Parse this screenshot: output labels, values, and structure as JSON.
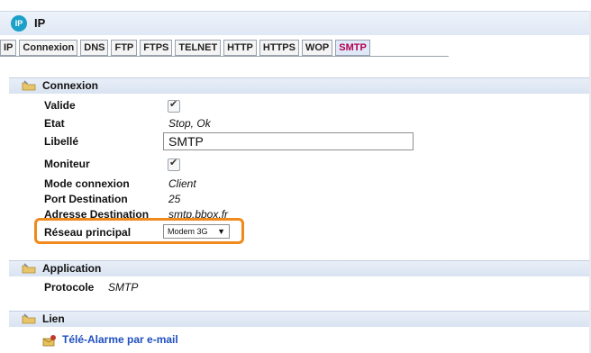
{
  "window": {
    "title": "IP",
    "logo_text": "IP"
  },
  "tabs": [
    {
      "label": "IP",
      "active": false
    },
    {
      "label": "Connexion",
      "active": false
    },
    {
      "label": "DNS",
      "active": false
    },
    {
      "label": "FTP",
      "active": false
    },
    {
      "label": "FTPS",
      "active": false
    },
    {
      "label": "TELNET",
      "active": false
    },
    {
      "label": "HTTP",
      "active": false
    },
    {
      "label": "HTTPS",
      "active": false
    },
    {
      "label": "WOP",
      "active": false
    },
    {
      "label": "SMTP",
      "active": true
    }
  ],
  "connexion": {
    "title": "Connexion",
    "valide_label": "Valide",
    "valide_checked": true,
    "etat_label": "Etat",
    "etat_value": "Stop, Ok",
    "libelle_label": "Libellé",
    "libelle_value": "SMTP",
    "moniteur_label": "Moniteur",
    "moniteur_checked": true,
    "mode_label": "Mode connexion",
    "mode_value": "Client",
    "port_label": "Port Destination",
    "port_value": "25",
    "adresse_label": "Adresse Destination",
    "adresse_value": "smtp.bbox.fr",
    "reseau_label": "Réseau principal",
    "reseau_value": "Modem 3G"
  },
  "application": {
    "title": "Application",
    "protocole_label": "Protocole",
    "protocole_value": "SMTP"
  },
  "lien": {
    "title": "Lien",
    "link_label": "Télé-Alarme par e-mail"
  },
  "colors": {
    "highlight": "#f08a1c",
    "active_tab_text": "#b4004e",
    "link": "#1f4fbf"
  },
  "icons": {
    "section": "folder-wrench-icon",
    "link": "alarm-email-icon",
    "checkmark": "checkmark-icon"
  }
}
